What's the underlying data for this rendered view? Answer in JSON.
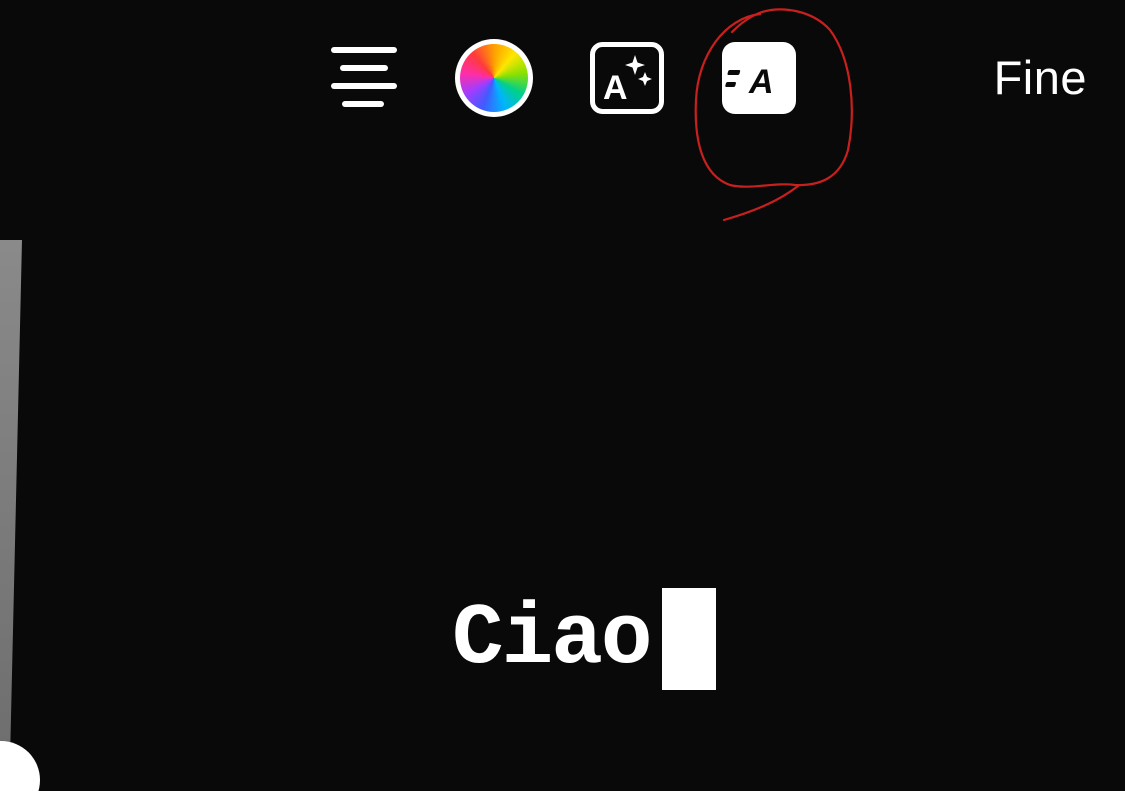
{
  "toolbar": {
    "align_icon": "align-center-icon",
    "color_icon": "color-wheel-icon",
    "effects_icon": "text-effects-icon",
    "animate_icon": "text-animation-icon",
    "done_label": "Fine"
  },
  "editor": {
    "text": "Ciao"
  },
  "colors": {
    "background": "#0a0909",
    "foreground": "#ffffff",
    "annotation": "#c8201e"
  }
}
